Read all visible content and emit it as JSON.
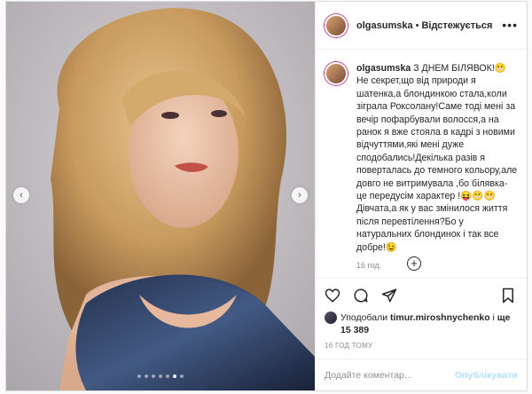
{
  "post": {
    "username": "olgasumska",
    "separator": "•",
    "follow_label": "Відстежується",
    "more_icon": "more-horizontal-icon",
    "caption_user": "olgasumska",
    "caption_text": "З ДНЕМ БІЛЯВОК!😬Не секрет,що від природи я шатенка,а блондинкою стала,коли зіграла Роксолану!Саме тоді мені за вечір пофарбували волосся,а на ранок я вже стояла в кадрі з новими відчуттями,які мені дуже сподобались!Декілька разів я поверталась до темного кольору,але довго не витримувала ,бо білявка-це передусім характер !😝😬😬Дівчата,а як у вас змінилося життя після перевтілення?Бо у натуральних блондинок і так все добре!😉",
    "caption_time": "16 год.",
    "load_more_icon": "plus-circle-icon"
  },
  "media": {
    "prev_icon": "chevron-left-icon",
    "next_icon": "chevron-right-icon",
    "slide_count": 7,
    "active_slide": 6
  },
  "actions": {
    "like_icon": "heart-icon",
    "comment_icon": "comment-icon",
    "share_icon": "send-icon",
    "save_icon": "bookmark-icon"
  },
  "likes": {
    "prefix": "Уподобали",
    "user": "timur.miroshnychenko",
    "mid": "і",
    "others": "ще 15 389"
  },
  "date": "16 ГОД ТОМУ",
  "comment": {
    "placeholder": "Додайте коментар...",
    "post_label": "Опублікувати"
  }
}
